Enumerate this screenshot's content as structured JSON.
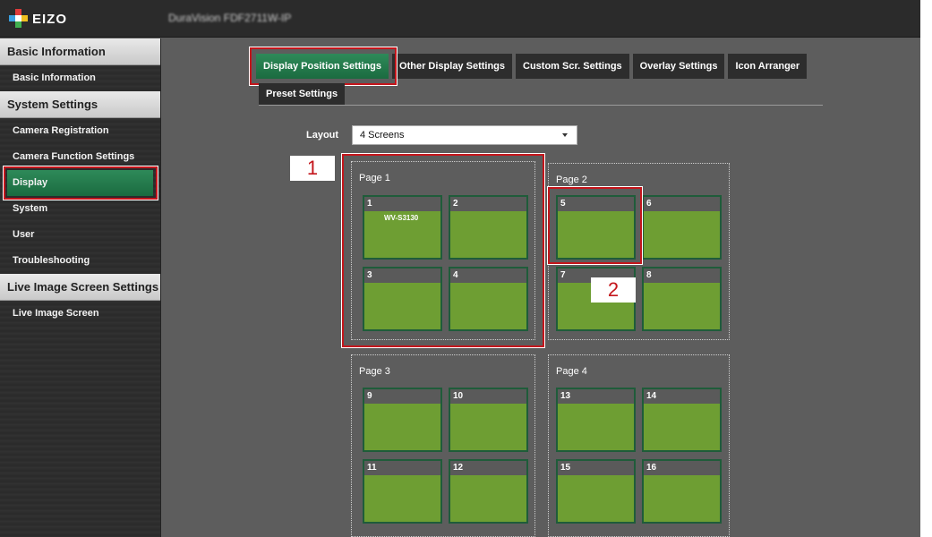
{
  "brand": {
    "logo_text": "EIZO",
    "product_name": "DuraVision FDF2711W-IP"
  },
  "sidebar": {
    "sections": [
      {
        "header": "Basic Information",
        "items": [
          "Basic Information"
        ]
      },
      {
        "header": "System Settings",
        "items": [
          "Camera Registration",
          "Camera Function Settings",
          "Display",
          "System",
          "User",
          "Troubleshooting"
        ]
      },
      {
        "header": "Live Image Screen Settings",
        "items": [
          "Live Image Screen"
        ]
      }
    ],
    "active_item": "Display"
  },
  "tabs": {
    "row1": [
      "Display Position Settings",
      "Other Display Settings",
      "Custom Scr. Settings",
      "Overlay Settings",
      "Icon Arranger"
    ],
    "row2": [
      "Preset Settings"
    ],
    "active": "Display Position Settings"
  },
  "layout": {
    "label": "Layout",
    "value": "4 Screens"
  },
  "pages": [
    {
      "title": "Page 1",
      "screens": [
        {
          "num": "1",
          "camera": "WV-S3130"
        },
        {
          "num": "2",
          "camera": ""
        },
        {
          "num": "3",
          "camera": ""
        },
        {
          "num": "4",
          "camera": ""
        }
      ]
    },
    {
      "title": "Page 2",
      "screens": [
        {
          "num": "5",
          "camera": ""
        },
        {
          "num": "6",
          "camera": ""
        },
        {
          "num": "7",
          "camera": ""
        },
        {
          "num": "8",
          "camera": ""
        }
      ]
    },
    {
      "title": "Page 3",
      "screens": [
        {
          "num": "9",
          "camera": ""
        },
        {
          "num": "10",
          "camera": ""
        },
        {
          "num": "11",
          "camera": ""
        },
        {
          "num": "12",
          "camera": ""
        }
      ]
    },
    {
      "title": "Page 4",
      "screens": [
        {
          "num": "13",
          "camera": ""
        },
        {
          "num": "14",
          "camera": ""
        },
        {
          "num": "15",
          "camera": ""
        },
        {
          "num": "16",
          "camera": ""
        }
      ]
    }
  ],
  "callouts": [
    "1",
    "2"
  ],
  "colors": {
    "accent_green": "#1f7a4a",
    "screen_fill": "#6e9e33",
    "highlight_red": "#c4161c"
  }
}
